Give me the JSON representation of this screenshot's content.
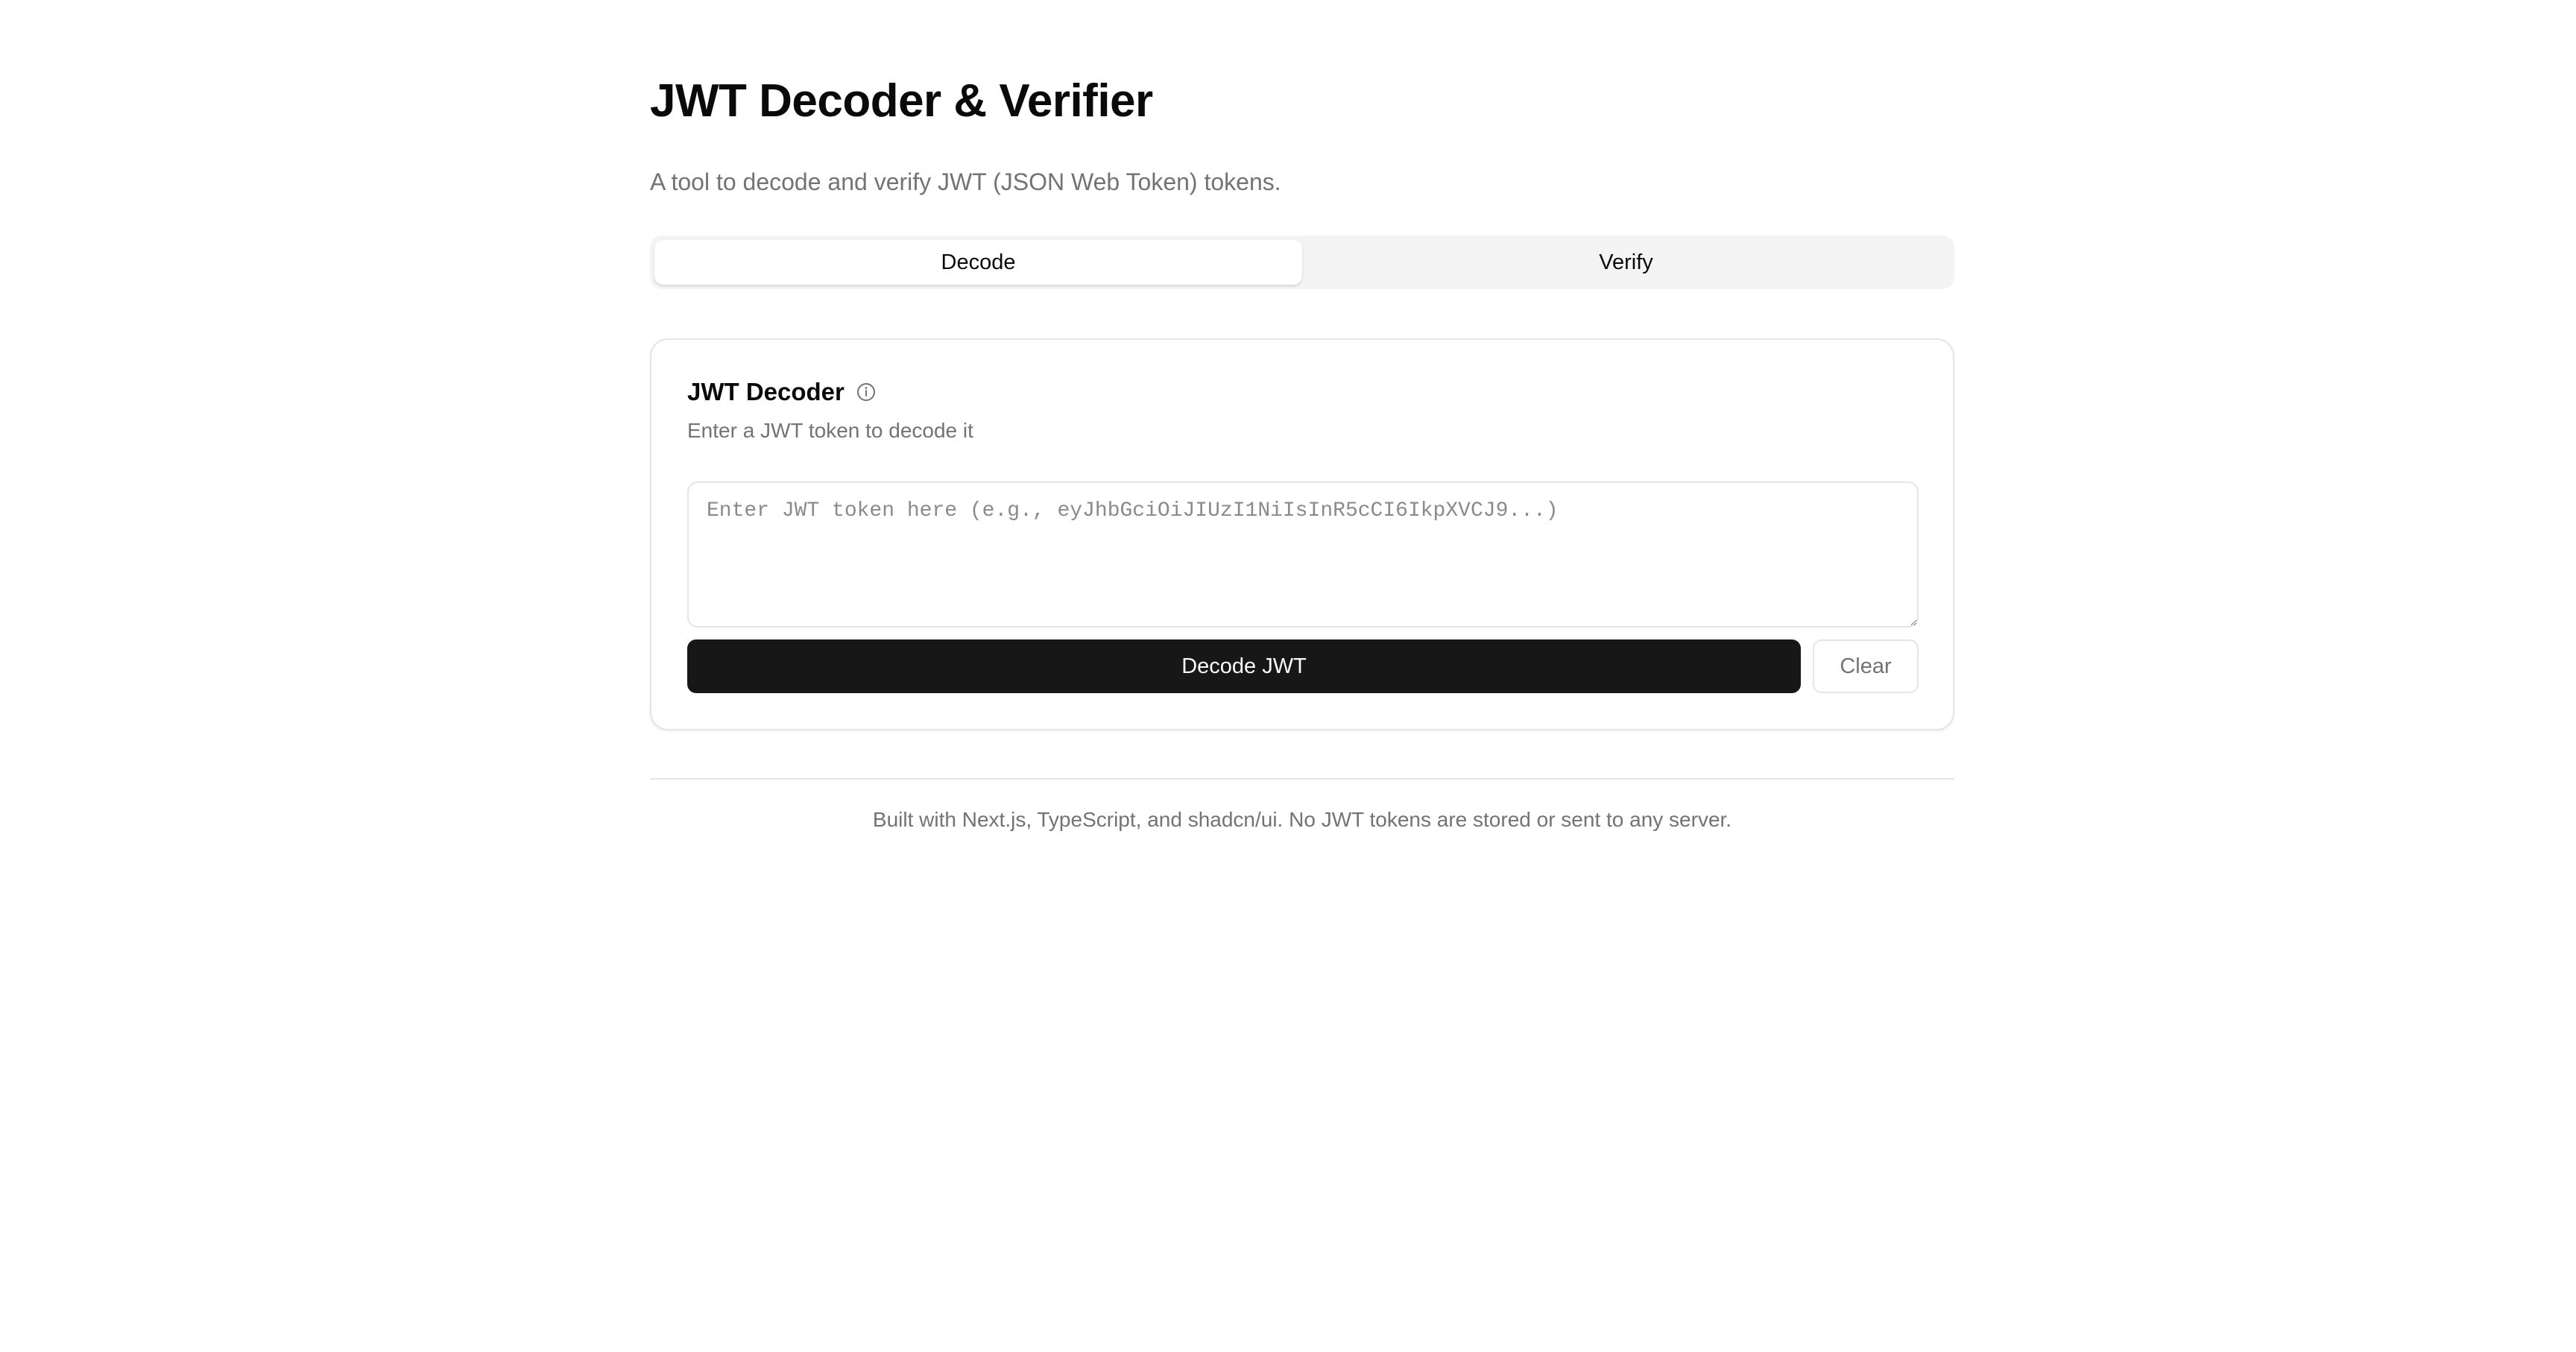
{
  "header": {
    "title": "JWT Decoder & Verifier",
    "subtitle": "A tool to decode and verify JWT (JSON Web Token) tokens."
  },
  "tabs": [
    {
      "label": "Decode",
      "active": true
    },
    {
      "label": "Verify",
      "active": false
    }
  ],
  "decoder_card": {
    "title": "JWT Decoder",
    "info_icon": "info-icon",
    "description": "Enter a JWT token to decode it",
    "token_input": {
      "value": "",
      "placeholder": "Enter JWT token here (e.g., eyJhbGciOiJIUzI1NiIsInR5cCI6IkpXVCJ9...)"
    },
    "decode_button_label": "Decode JWT",
    "clear_button_label": "Clear"
  },
  "footer": {
    "text": "Built with Next.js, TypeScript, and shadcn/ui. No JWT tokens are stored or sent to any server."
  },
  "colors": {
    "primary_button": "#171717",
    "muted_text": "#737373",
    "border": "#e5e5e5",
    "tab_track": "#f4f4f5"
  }
}
